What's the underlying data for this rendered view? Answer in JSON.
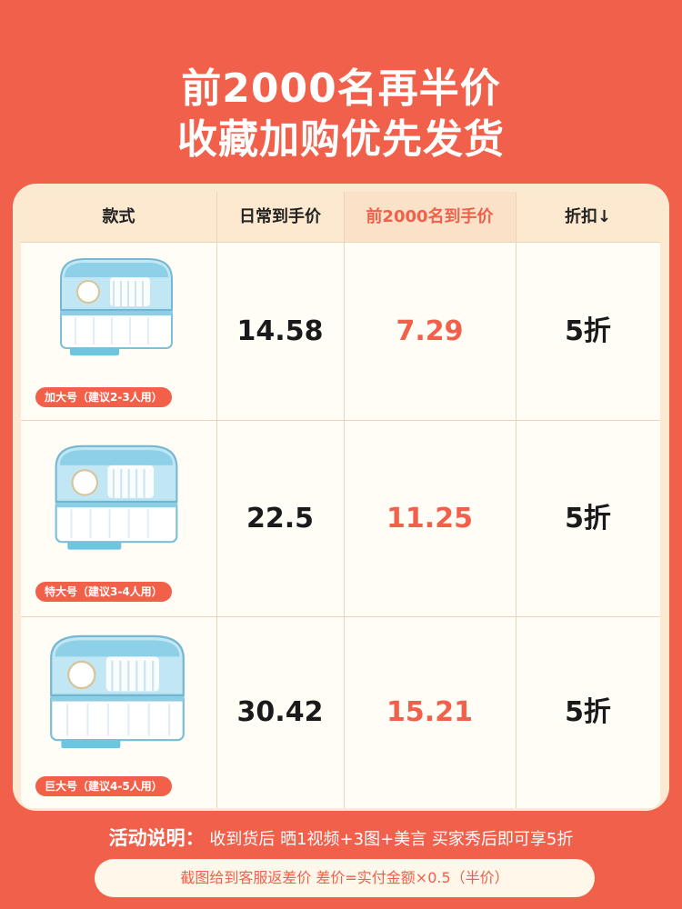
{
  "headline": {
    "line1": "前2000名再半价",
    "line2": "收藏加购优先发货"
  },
  "table": {
    "headers": [
      "款式",
      "日常到手价",
      "前2000名到手价",
      "折扣↓"
    ],
    "rows": [
      {
        "tag": "加大号（建议2-3人用）",
        "normal_price": "14.58",
        "sale_price": "7.29",
        "discount": "5折"
      },
      {
        "tag": "特大号（建议3-4人用）",
        "normal_price": "22.5",
        "sale_price": "11.25",
        "discount": "5折"
      },
      {
        "tag": "巨大号（建议4-5人用）",
        "normal_price": "30.42",
        "sale_price": "15.21",
        "discount": "5折"
      }
    ]
  },
  "footer": {
    "label": "活动说明：",
    "text": "收到货后 晒1视频+3图+美言 买家秀后即可享5折",
    "note": "截图给到客服返差价  差价=实付金额×0.5（半价）"
  },
  "colors": {
    "background": "#f0604a",
    "accent": "#f0604a",
    "card": "#fbe9d2",
    "header_row": "#fce9d0"
  },
  "icons": [
    "dish-rack-product-image"
  ]
}
